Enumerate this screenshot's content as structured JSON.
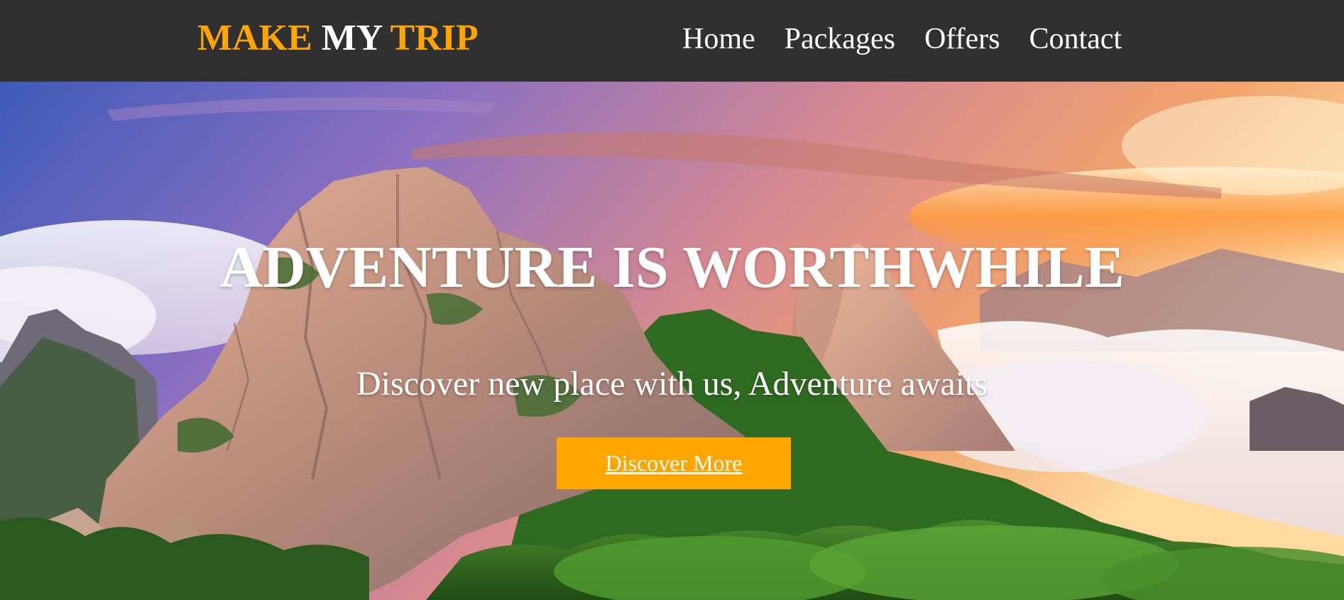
{
  "header": {
    "logo": {
      "part1": "MAKE",
      "part2": "MY",
      "part3": "TRIP"
    },
    "nav": [
      "Home",
      "Packages",
      "Offers",
      "Contact"
    ]
  },
  "hero": {
    "headline": "ADVENTURE IS WORTHWHILE",
    "subheadline": "Discover new place with us, Adventure awaits",
    "cta_label": "Discover More",
    "background_image": "mountain-sunset-landscape"
  },
  "colors": {
    "navbar_bg": "#303030",
    "accent": "#ffa500",
    "text": "#ffffff"
  }
}
